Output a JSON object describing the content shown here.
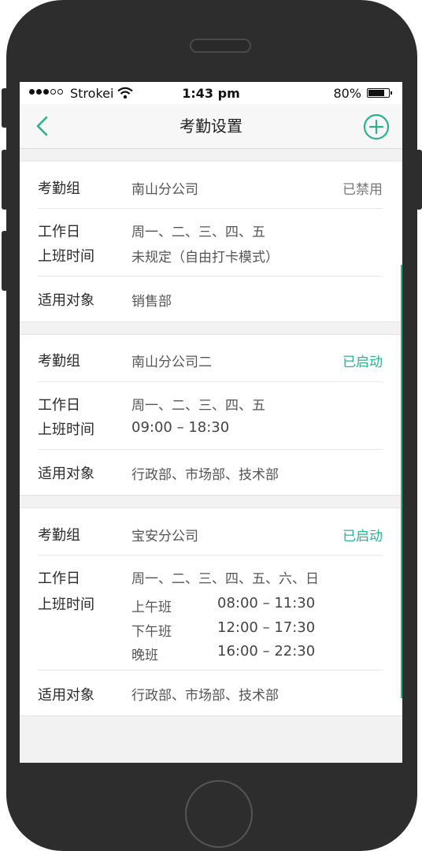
{
  "status_bar": {
    "carrier": "Strokei",
    "time": "1:43 pm",
    "battery": "80%",
    "battery_level": 0.8
  },
  "nav": {
    "title": "考勤设置",
    "back_icon": "chevron-left-icon",
    "add_icon": "plus-circle-icon"
  },
  "colors": {
    "accent": "#2bb38a",
    "disabled_text": "#777777",
    "background": "#f2f2f2",
    "frame": "#2d2d2d"
  },
  "labels": {
    "group": "考勤组",
    "workdays": "工作日",
    "hours": "上班时间",
    "applies_to": "适用对象"
  },
  "groups": [
    {
      "name": "南山分公司",
      "status": "已禁用",
      "enabled": false,
      "workdays": "周一、二、三、四、五",
      "hours": "未规定（自由打卡模式）",
      "applies_to": "销售部"
    },
    {
      "name": "南山分公司二",
      "status": "已启动",
      "enabled": true,
      "workdays": "周一、二、三、四、五",
      "hours": "09:00 – 18:30",
      "applies_to": "行政部、市场部、技术部"
    },
    {
      "name": "宝安分公司",
      "status": "已启动",
      "enabled": true,
      "workdays": "周一、二、三、四、五、六、日",
      "shifts": [
        {
          "name": "上午班",
          "time": "08:00 – 11:30"
        },
        {
          "name": "下午班",
          "time": "12:00 – 17:30"
        },
        {
          "name": "晚班",
          "time": "16:00 – 22:30"
        }
      ],
      "applies_to": "行政部、市场部、技术部"
    }
  ]
}
